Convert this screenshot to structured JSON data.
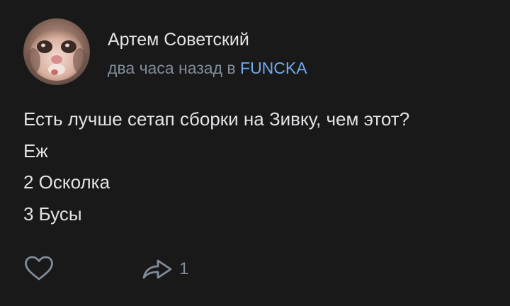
{
  "author": {
    "name": "Артем Советский",
    "avatar_icon": "cat-avatar"
  },
  "meta": {
    "time": "два часа назад в ",
    "group": "FUNCKA"
  },
  "post": {
    "lines": [
      "Есть лучше сетап сборки на Зивку, чем этот?",
      "Еж",
      "2 Осколка",
      "3 Бусы"
    ]
  },
  "actions": {
    "like_icon": "heart-icon",
    "share_icon": "share-arrow-icon",
    "share_count": "1"
  },
  "colors": {
    "background": "#19191a",
    "text": "#e1e3e6",
    "secondary": "#818c99",
    "link": "#71aaeb"
  }
}
